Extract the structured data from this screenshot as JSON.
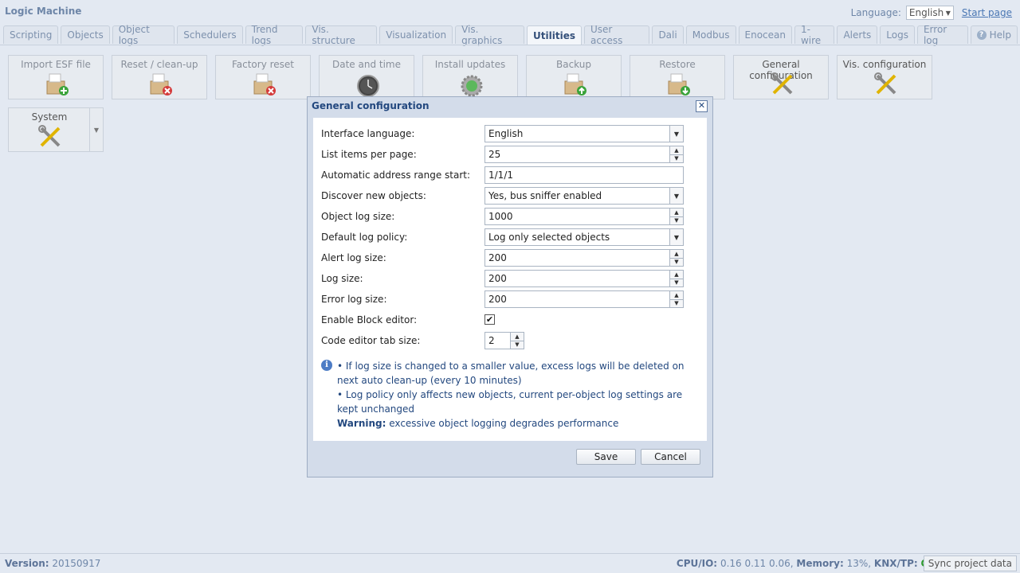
{
  "header": {
    "app_title": "Logic Machine",
    "language_label": "Language:",
    "language_value": "English",
    "start_page": "Start page"
  },
  "tabs": [
    {
      "label": "Scripting"
    },
    {
      "label": "Objects"
    },
    {
      "label": "Object logs"
    },
    {
      "label": "Schedulers"
    },
    {
      "label": "Trend logs"
    },
    {
      "label": "Vis. structure"
    },
    {
      "label": "Visualization"
    },
    {
      "label": "Vis. graphics"
    },
    {
      "label": "Utilities",
      "active": true
    },
    {
      "label": "User access"
    },
    {
      "label": "Dali"
    },
    {
      "label": "Modbus"
    },
    {
      "label": "Enocean"
    },
    {
      "label": "1-wire"
    },
    {
      "label": "Alerts"
    },
    {
      "label": "Logs"
    },
    {
      "label": "Error log"
    },
    {
      "label": "Help"
    }
  ],
  "tiles": [
    {
      "label": "Import ESF file",
      "icon": "box-add-icon"
    },
    {
      "label": "Reset / clean-up",
      "icon": "box-remove-icon"
    },
    {
      "label": "Factory reset",
      "icon": "box-remove-icon"
    },
    {
      "label": "Date and time",
      "icon": "clock-icon"
    },
    {
      "label": "Install updates",
      "icon": "gear-refresh-icon"
    },
    {
      "label": "Backup",
      "icon": "box-upload-icon"
    },
    {
      "label": "Restore",
      "icon": "box-download-icon"
    },
    {
      "label": "General configuration",
      "icon": "tools-icon"
    },
    {
      "label": "Vis. configuration",
      "icon": "tools-icon"
    },
    {
      "label": "System",
      "icon": "tools-icon"
    }
  ],
  "dialog": {
    "title": "General configuration",
    "fields": {
      "interface_language": {
        "label": "Interface language:",
        "value": "English"
      },
      "list_items": {
        "label": "List items per page:",
        "value": "25"
      },
      "address_range": {
        "label": "Automatic address range start:",
        "value": "1/1/1"
      },
      "discover": {
        "label": "Discover new objects:",
        "value": "Yes, bus sniffer enabled"
      },
      "object_log_size": {
        "label": "Object log size:",
        "value": "1000"
      },
      "default_log_policy": {
        "label": "Default log policy:",
        "value": "Log only selected objects"
      },
      "alert_log_size": {
        "label": "Alert log size:",
        "value": "200"
      },
      "log_size": {
        "label": "Log size:",
        "value": "200"
      },
      "error_log_size": {
        "label": "Error log size:",
        "value": "200"
      },
      "block_editor": {
        "label": "Enable Block editor:",
        "checked": true
      },
      "tab_size": {
        "label": "Code editor tab size:",
        "value": "2"
      }
    },
    "info": {
      "line1": "• If log size is changed to a smaller value, excess logs will be deleted on next auto clean-up (every 10 minutes)",
      "line2": "• Log policy only affects new objects, current per-object log settings are kept unchanged",
      "warning_label": "Warning:",
      "warning_text": "excessive object logging degrades performance"
    },
    "save_label": "Save",
    "cancel_label": "Cancel"
  },
  "footer": {
    "version_label": "Version:",
    "version_value": "20150917",
    "cpu_label": "CPU/IO:",
    "cpu_value": "0.16 0.11 0.06,",
    "memory_label": "Memory:",
    "memory_value": "13%,",
    "knx_label": "KNX/TP:",
    "knx_value": "OK",
    "sync_label": "Sync project data"
  }
}
